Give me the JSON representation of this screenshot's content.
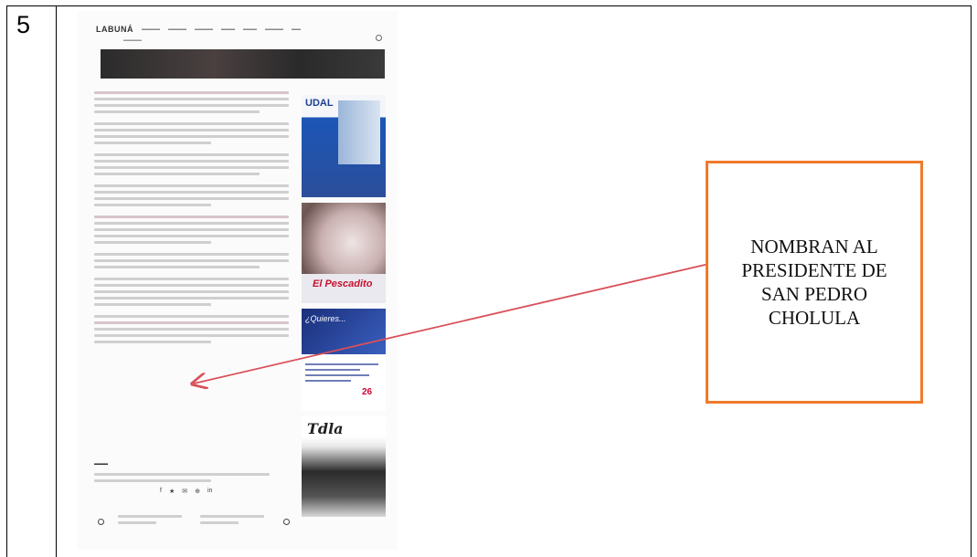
{
  "row_number": "5",
  "site": {
    "logo": "LABUNÁ",
    "nav_items": [
      "",
      "",
      "",
      "",
      "",
      "",
      ""
    ],
    "sub_nav": "",
    "social_icons": [
      "f",
      "★",
      "✉",
      "⊕",
      "in"
    ]
  },
  "annotation": {
    "lines": [
      "NOMBRAN AL",
      "PRESIDENTE DE",
      "SAN PEDRO",
      "CHOLULA"
    ]
  },
  "colors": {
    "annotation_border": "#f07a2a",
    "arrow": "#d9505a"
  }
}
